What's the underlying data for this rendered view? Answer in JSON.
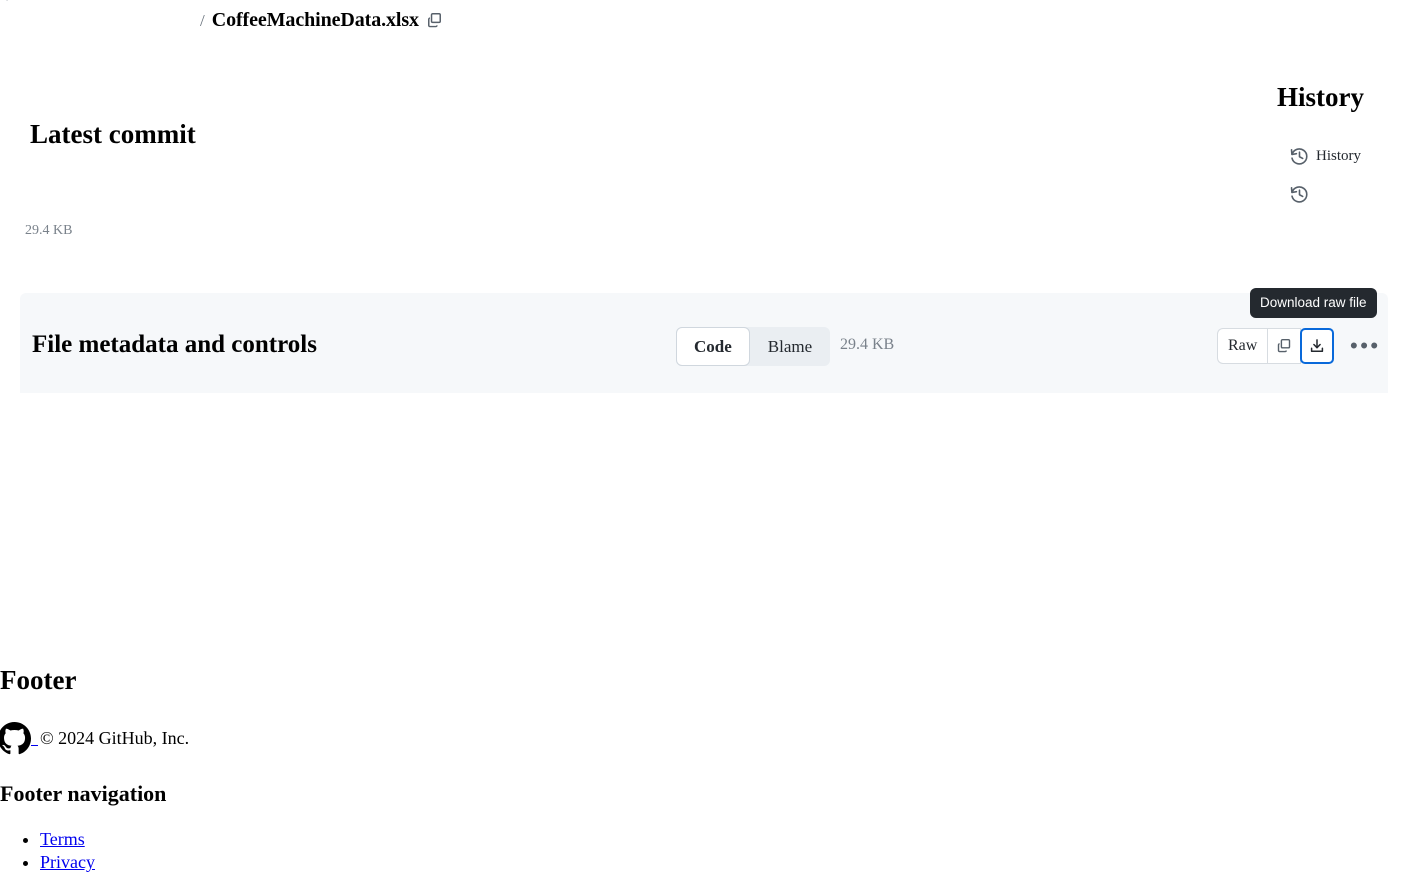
{
  "breadcrumb": {
    "separator": "/",
    "file_name": "CoffeeMachineData.xlsx",
    "copy_path_icon": "copy-icon"
  },
  "latest_commit": {
    "heading": "Latest commit"
  },
  "history": {
    "heading": "History",
    "link_label": "History",
    "icon": "history-icon"
  },
  "file": {
    "size_above_bar": "29.4 KB",
    "size_in_bar": "29.4 KB"
  },
  "file_meta": {
    "heading": "File metadata and controls",
    "view_toggle": {
      "options": [
        "Code",
        "Blame"
      ],
      "selected": "Code"
    },
    "actions": {
      "raw_label": "Raw",
      "copy_icon": "copy-icon",
      "download_icon": "download-icon",
      "overflow_label": "•••",
      "tooltip": "Download raw file"
    }
  },
  "footer": {
    "heading": "Footer",
    "copyright": "© 2024 GitHub, Inc.",
    "github_mark": "github-logo-icon",
    "nav_heading": "Footer navigation",
    "nav_items": [
      {
        "label": "Terms"
      },
      {
        "label": "Privacy"
      }
    ]
  },
  "colors": {
    "focus_blue": "#0969da",
    "link_blue": "#0000ee",
    "bar_bg": "#f6f8fa",
    "tooltip_bg": "#24292f",
    "muted_text": "#7a828b"
  }
}
